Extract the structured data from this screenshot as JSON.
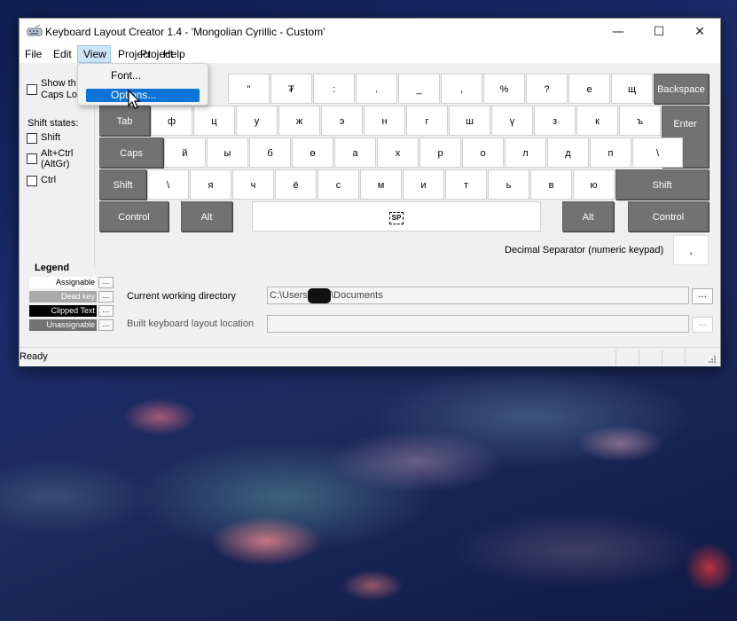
{
  "window": {
    "title": "Keyboard Layout Creator 1.4 - 'Mongolian Cyrillic - Custom'",
    "minimize_glyph": "—",
    "maximize_glyph": "☐",
    "close_glyph": "✕"
  },
  "menubar": {
    "file": "File",
    "edit": "Edit",
    "view": "View",
    "project": "Project",
    "help": "Help"
  },
  "view_menu": {
    "font": "Font...",
    "options": "Options..."
  },
  "left_panel": {
    "show_line1": "Show th",
    "show_line2": "Caps Lo",
    "shift_states_label": "Shift states:",
    "shift": "Shift",
    "altctrl_line1": "Alt+Ctrl",
    "altctrl_line2": "(AltGr)",
    "ctrl": "Ctrl"
  },
  "keyboard": {
    "row1": [
      "\"",
      "₮",
      ":",
      ".",
      "_",
      ",",
      "%",
      "?",
      "е",
      "щ"
    ],
    "backspace": "Backspace",
    "tab": "Tab",
    "row2": [
      "ф",
      "ц",
      "у",
      "ж",
      "э",
      "н",
      "г",
      "ш",
      "ү",
      "з",
      "к",
      "ъ"
    ],
    "enter": "Enter",
    "caps": "Caps",
    "row3": [
      "й",
      "ы",
      "б",
      "ө",
      "а",
      "х",
      "р",
      "о",
      "л",
      "д",
      "п",
      "\\"
    ],
    "shift_left": "Shift",
    "row4": [
      "\\",
      "я",
      "ч",
      "ё",
      "с",
      "м",
      "и",
      "т",
      "ь",
      "в",
      "ю"
    ],
    "shift_right": "Shift",
    "control_left": "Control",
    "alt_left": "Alt",
    "space_label": "SP",
    "alt_right": "Alt",
    "control_right": "Control",
    "decimal_label": "Decimal Separator (numeric keypad)",
    "decimal_value": ","
  },
  "legend": {
    "title": "Legend",
    "assignable": "Assignable",
    "dead_key": "Dead key",
    "clipped_text": "Clipped Text",
    "unassignable": "Unassignable",
    "button": "...",
    "colors": {
      "assignable": "#ffffff",
      "dead_key": "#a9a9a9",
      "clipped_text": "#000000",
      "unassignable": "#727272"
    }
  },
  "paths": {
    "cwd_label": "Current working directory",
    "cwd_prefix": "C:\\Users\\",
    "cwd_suffix": "\\Documents",
    "build_label": "Built keyboard layout location",
    "build_value": "",
    "browse": "..."
  },
  "status": {
    "text": "Ready"
  },
  "accent": "#0a74d9"
}
